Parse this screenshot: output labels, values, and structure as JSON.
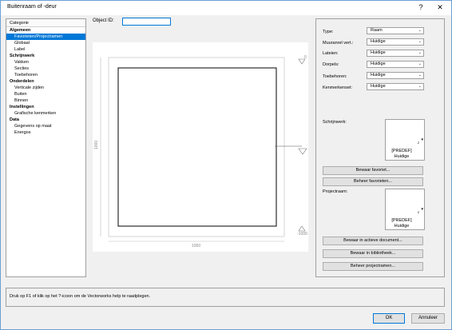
{
  "window": {
    "title": "Buitenraam of -deur",
    "help_button": "?",
    "close_button": "✕"
  },
  "categories": {
    "header": "Categorie",
    "items": [
      {
        "label": "Algemeen",
        "kind": "group",
        "selected": false
      },
      {
        "label": "Favorieten/Projectramen",
        "kind": "sub",
        "selected": true
      },
      {
        "label": "Globaal",
        "kind": "sub",
        "selected": false
      },
      {
        "label": "Label",
        "kind": "sub",
        "selected": false
      },
      {
        "label": "Schrijnwerk",
        "kind": "group",
        "selected": false
      },
      {
        "label": "Vakken",
        "kind": "sub",
        "selected": false
      },
      {
        "label": "Secties",
        "kind": "sub",
        "selected": false
      },
      {
        "label": "Toebehoren",
        "kind": "sub",
        "selected": false
      },
      {
        "label": "Onderdelen",
        "kind": "group",
        "selected": false
      },
      {
        "label": "Verticale zijden",
        "kind": "sub",
        "selected": false
      },
      {
        "label": "Buiten",
        "kind": "sub",
        "selected": false
      },
      {
        "label": "Binnen",
        "kind": "sub",
        "selected": false
      },
      {
        "label": "Instellingen",
        "kind": "group",
        "selected": false
      },
      {
        "label": "Grafische kenmerken",
        "kind": "sub",
        "selected": false
      },
      {
        "label": "Data",
        "kind": "group",
        "selected": false
      },
      {
        "label": "Gegevens op maat",
        "kind": "sub",
        "selected": false
      },
      {
        "label": "Energos",
        "kind": "sub",
        "selected": false
      }
    ]
  },
  "object_id": {
    "label": "Object ID:",
    "value": ""
  },
  "preview": {
    "width_dim": "1000",
    "height_dim": "1000",
    "corner_dim": "-1000",
    "top_dim": "0"
  },
  "properties": {
    "rows": [
      {
        "label": "Type:",
        "value": "Raam"
      },
      {
        "label": "Muuranrel vert.:",
        "value": "Huidige"
      },
      {
        "label": "Lateien:",
        "value": "Huidige"
      },
      {
        "label": "Dorpels:",
        "value": "Huidige"
      },
      {
        "label": "Toebehoren:",
        "value": "Huidige"
      },
      {
        "label": "Kenmerkenset:",
        "value": "Huidige"
      }
    ],
    "schrijnwerk": {
      "label": "Schrijnwerk:",
      "name": "[PREDEF]",
      "sub": "Huidige",
      "num": "2"
    },
    "bewaar_favoriet": "Bewaar favoriet...",
    "beheer_favorieten": "Beheer favorieten...",
    "projectraam": {
      "label": "Projectraam:",
      "name": "[PREDEF]",
      "sub": "Huidige",
      "num": "2"
    },
    "bewaar_document": "Bewaar in actieve document...",
    "bewaar_bibliotheek": "Bewaar in bibliotheek...",
    "beheer_projectramen": "Beheer projectramen..."
  },
  "help": {
    "text": "Druk op F1 of klik op het ?-icoon om de Vectorworks help te raadplegen."
  },
  "footer": {
    "ok": "OK",
    "cancel": "Annuleer"
  }
}
